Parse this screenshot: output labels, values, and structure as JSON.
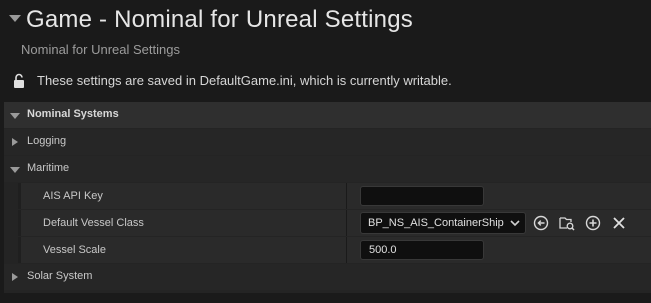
{
  "header": {
    "title": "Game - Nominal for Unreal Settings",
    "subtitle": "Nominal for Unreal Settings",
    "notice": "These settings are saved in DefaultGame.ini, which is currently writable."
  },
  "sections": {
    "main": "Nominal Systems",
    "logging": "Logging",
    "maritime": "Maritime",
    "solar": "Solar System"
  },
  "maritime": {
    "ais_api_key": {
      "label": "AIS API Key",
      "value": ""
    },
    "default_vessel_class": {
      "label": "Default Vessel Class",
      "value": "BP_NS_AIS_ContainerShip"
    },
    "vessel_scale": {
      "label": "Vessel Scale",
      "value": "500.0"
    }
  },
  "icons": {
    "lock": "unlock-icon",
    "use_selected": "use-selected-asset-icon",
    "browse": "browse-folder-icon",
    "add": "add-icon",
    "clear": "clear-icon"
  },
  "colors": {
    "background": "#1a1a1a",
    "panel": "#242424",
    "section_header": "#2f2f2f",
    "input_bg": "#0f0f0f"
  }
}
